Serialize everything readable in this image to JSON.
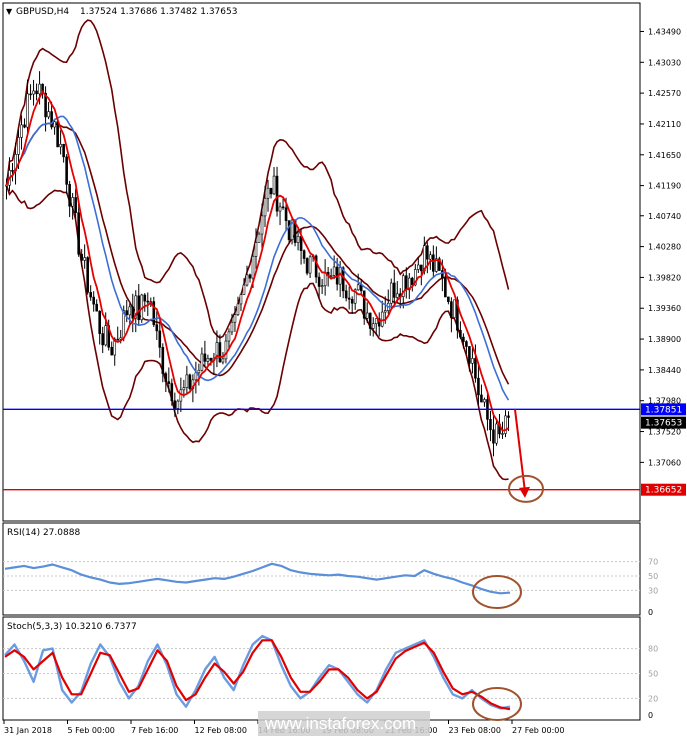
{
  "header": {
    "symbol": "GBPUSD,H4",
    "ohlc": "1.37524 1.37686 1.37482 1.37653"
  },
  "colors": {
    "candle": "#000000",
    "bollinger": "#6b0000",
    "ma_fast": "#e60000",
    "ma_slow": "#3b6fd6",
    "level_blue": "#0000ff",
    "level_red": "#e00000",
    "rsi": "#5b8fd9",
    "stoch_main": "#6b9be0",
    "stoch_signal": "#e00000",
    "circle": "#a0522d",
    "arrow": "#e00000"
  },
  "watermark": "www.instaforex.com",
  "chart_data": [
    {
      "type": "candlestick",
      "panel": "price",
      "ylim": [
        1.362,
        1.439
      ],
      "yticks": [
        "1.43490",
        "1.43030",
        "1.42570",
        "1.42110",
        "1.41650",
        "1.41190",
        "1.40740",
        "1.40280",
        "1.39820",
        "1.39360",
        "1.38900",
        "1.38440",
        "1.37980",
        "1.37520",
        "1.37060"
      ],
      "ytick_values": [
        1.4349,
        1.4303,
        1.4257,
        1.4211,
        1.4165,
        1.4119,
        1.4074,
        1.4028,
        1.3982,
        1.3936,
        1.389,
        1.3844,
        1.3798,
        1.3752,
        1.3706
      ],
      "xticks": [
        "31 Jan 2018",
        "5 Feb 00:00",
        "7 Feb 16:00",
        "12 Feb 08:00",
        "14 Feb 16:00",
        "19 Feb 08:00",
        "21 Feb 16:00",
        "23 Feb 08:00",
        "27 Feb 00:00"
      ],
      "close_path": [
        1.412,
        1.418,
        1.423,
        1.427,
        1.4245,
        1.421,
        1.4165,
        1.408,
        1.4005,
        1.395,
        1.39,
        1.3875,
        1.3905,
        1.3945,
        1.393,
        1.396,
        1.388,
        1.383,
        1.38,
        1.3815,
        1.384,
        1.386,
        1.3875,
        1.387,
        1.39,
        1.396,
        1.402,
        1.408,
        1.412,
        1.409,
        1.405,
        1.402,
        1.4,
        1.399,
        1.3975,
        1.3985,
        1.397,
        1.396,
        1.393,
        1.392,
        1.3945,
        1.397,
        1.398,
        1.399,
        1.402,
        1.4,
        1.3975,
        1.394,
        1.391,
        1.387,
        1.38,
        1.376,
        1.374,
        1.3765
      ],
      "levels": [
        {
          "value": 1.37851,
          "label": "1.37851",
          "color": "#0000ff"
        },
        {
          "value": 1.36652,
          "label": "1.36652",
          "color": "#e00000"
        }
      ],
      "current_price": {
        "value": 1.37653,
        "label": "1.37653"
      },
      "arrow": {
        "from": 1.3785,
        "to": 1.3665
      }
    },
    {
      "type": "line",
      "panel": "rsi",
      "title": "RSI(14) 27.0888",
      "ylim": [
        0,
        100
      ],
      "yticks": [
        "70",
        "50",
        "30",
        "0"
      ],
      "ytick_values": [
        70,
        50,
        30,
        0
      ],
      "series": [
        {
          "values": [
            60,
            62,
            64,
            61,
            63,
            66,
            62,
            58,
            52,
            48,
            45,
            41,
            39,
            40,
            42,
            44,
            46,
            44,
            42,
            41,
            43,
            45,
            47,
            46,
            49,
            53,
            57,
            62,
            67,
            64,
            58,
            55,
            53,
            52,
            51,
            52,
            50,
            49,
            47,
            45,
            47,
            49,
            51,
            50,
            58,
            53,
            49,
            46,
            41,
            37,
            32,
            28,
            26,
            27
          ]
        }
      ]
    },
    {
      "type": "line",
      "panel": "stochastic",
      "title": "Stoch(5,3,3) 10.3210 6.7377",
      "ylim": [
        0,
        100
      ],
      "yticks": [
        "80",
        "50",
        "20",
        "0"
      ],
      "ytick_values": [
        80,
        50,
        20,
        0
      ],
      "series": [
        {
          "values": [
            72,
            85,
            65,
            40,
            78,
            80,
            30,
            15,
            28,
            62,
            85,
            70,
            40,
            20,
            35,
            65,
            85,
            60,
            25,
            10,
            30,
            55,
            70,
            45,
            30,
            60,
            85,
            95,
            90,
            60,
            35,
            20,
            28,
            45,
            60,
            55,
            40,
            25,
            15,
            30,
            55,
            75,
            80,
            85,
            90,
            70,
            45,
            25,
            20,
            30,
            20,
            12,
            8,
            10
          ]
        },
        {
          "values": [
            70,
            78,
            70,
            55,
            65,
            75,
            45,
            25,
            25,
            50,
            75,
            72,
            50,
            28,
            32,
            55,
            78,
            65,
            35,
            18,
            25,
            45,
            62,
            52,
            38,
            52,
            75,
            90,
            90,
            70,
            45,
            28,
            28,
            40,
            55,
            55,
            45,
            30,
            20,
            28,
            48,
            68,
            77,
            82,
            87,
            75,
            52,
            32,
            25,
            28,
            22,
            14,
            9,
            7
          ]
        }
      ]
    }
  ]
}
